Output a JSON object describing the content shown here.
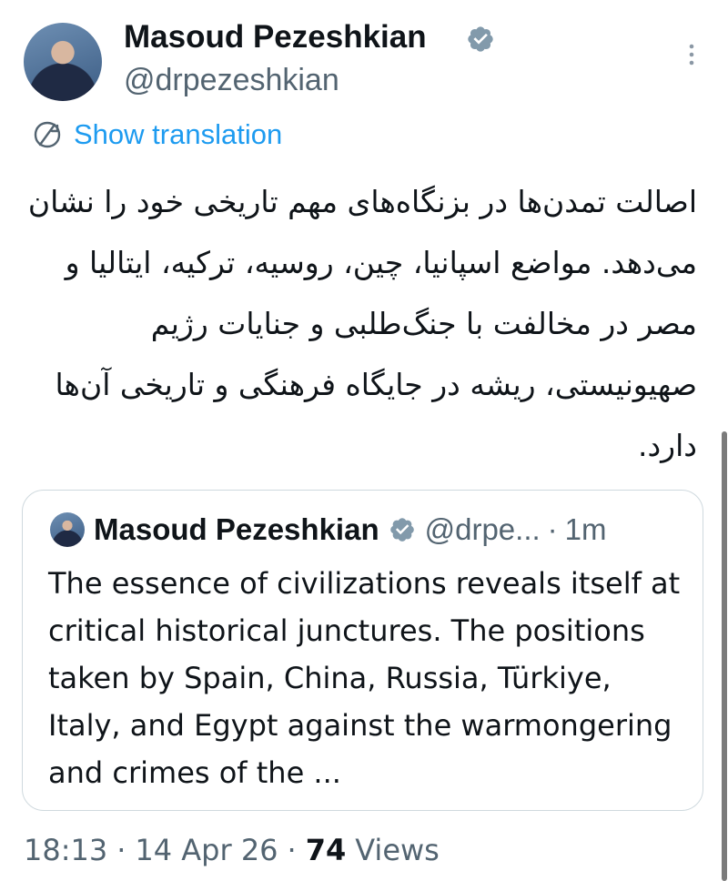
{
  "author": {
    "display_name": "Masoud Pezeshkian",
    "handle": "@drpezeshkian",
    "verified_icon": "verified-badge-icon"
  },
  "translate": {
    "label": "Show translation",
    "icon": "translate-icon"
  },
  "post": {
    "text": "اصالت تمدن‌ها در بزنگاه‌های مهم تاریخی خود را نشان می‌دهد. مواضع اسپانیا، چین، روسیه، ترکیه، ایتالیا و مصر در مخالفت با جنگ‌طلبی و جنایات رژیم صهیونیستی، ریشه در جایگاه فرهنگی و تاریخی آن‌ها دارد."
  },
  "quote": {
    "display_name": "Masoud Pezeshkian",
    "handle": "@drpe...",
    "dot": "·",
    "time": "1m",
    "text": "The essence of civilizations reveals itself at critical historical junctures. The positions taken by Spain, China, Russia, Türkiye, Italy, and Egypt against the warmongering and crimes of the ..."
  },
  "meta": {
    "time": "18:13",
    "sep1": "·",
    "date": "14 Apr 26",
    "sep2": "·",
    "views_count": "74",
    "views_label": "Views"
  },
  "colors": {
    "accent": "#1d9bf0",
    "text": "#0f1419",
    "secondary": "#536471",
    "border": "#cfd9de"
  }
}
